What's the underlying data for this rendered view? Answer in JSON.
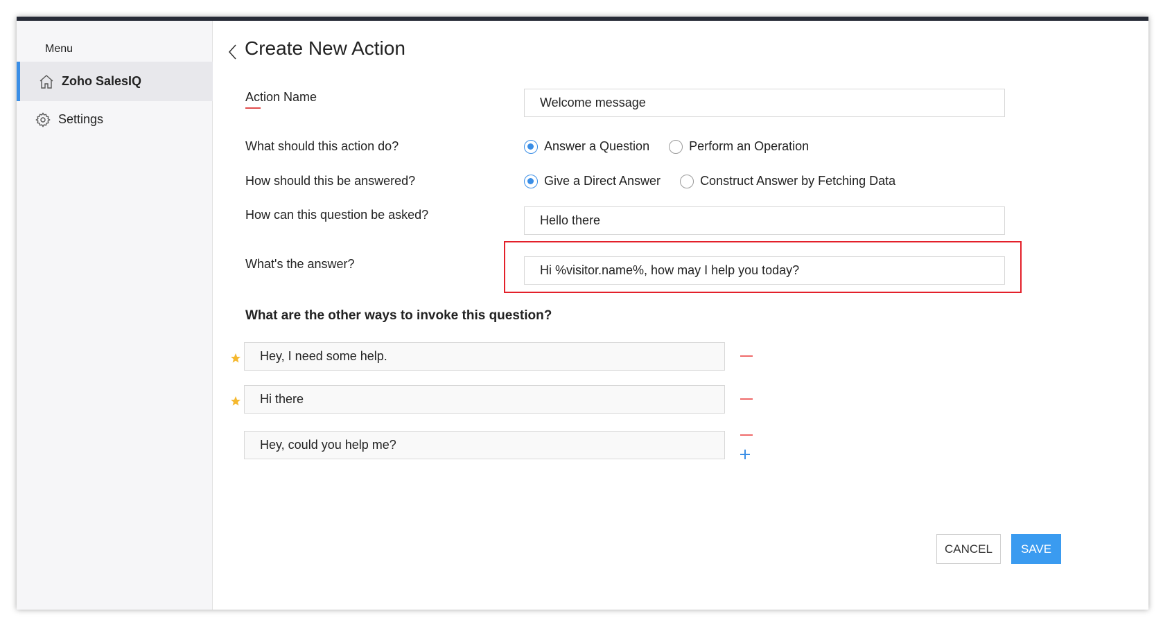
{
  "sidebar": {
    "menu_label": "Menu",
    "items": [
      {
        "label": "Zoho SalesIQ",
        "icon": "home-icon",
        "active": true
      },
      {
        "label": "Settings",
        "icon": "gear-icon",
        "active": false
      }
    ]
  },
  "header": {
    "title": "Create New Action",
    "back_icon": "chevron-left-icon"
  },
  "form": {
    "action_name": {
      "label": "Action Name",
      "value": "Welcome message"
    },
    "action_type": {
      "label": "What should this action do?",
      "options": [
        "Answer a Question",
        "Perform an Operation"
      ],
      "selected": "Answer a Question"
    },
    "answer_mode": {
      "label": "How should this be answered?",
      "options": [
        "Give a Direct Answer",
        "Construct Answer by Fetching Data"
      ],
      "selected": "Give a Direct Answer"
    },
    "question": {
      "label": "How can this question be asked?",
      "value": "Hello there"
    },
    "answer": {
      "label": "What's the answer?",
      "value": "Hi %visitor.name%, how may I help you today?"
    }
  },
  "other_ways": {
    "heading": "What are the other ways to invoke this question?",
    "items": [
      {
        "value": "Hey, I need some help.",
        "starred": true
      },
      {
        "value": "Hi there",
        "starred": true
      },
      {
        "value": "Hey, could you help me?",
        "starred": false
      }
    ]
  },
  "footer": {
    "cancel_label": "CANCEL",
    "save_label": "SAVE"
  },
  "colors": {
    "accent": "#3a8ee6",
    "save_button": "#3a9bf0",
    "highlight": "#e3202a",
    "remove": "#ef6a6a",
    "star": "#f5b82e",
    "title_bar": "#262a36"
  }
}
